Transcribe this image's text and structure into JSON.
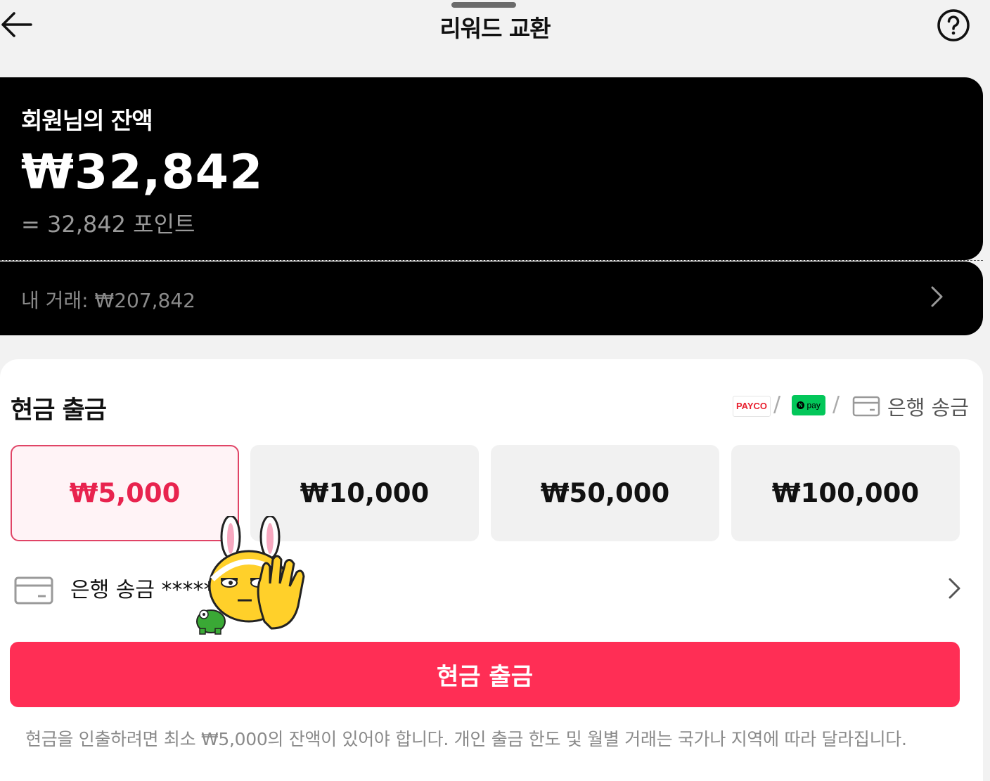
{
  "header": {
    "title": "리워드 교환",
    "back_icon": "arrow-left-icon",
    "help_icon": "question-circle-icon"
  },
  "balance": {
    "label": "회원님의 잔액",
    "amount": "₩32,842",
    "points": "= 32,842 포인트",
    "transactions": "내 거래: ₩207,842"
  },
  "withdraw": {
    "title": "현금 출금",
    "methods": {
      "payco": "PAYCO",
      "npay": "pay",
      "separator": "/",
      "bank": "은행 송금"
    },
    "amounts": [
      {
        "label": "₩5,000",
        "selected": true
      },
      {
        "label": "₩10,000",
        "selected": false
      },
      {
        "label": "₩50,000",
        "selected": false
      },
      {
        "label": "₩100,000",
        "selected": false
      }
    ],
    "bank_account": "은행 송금 *****",
    "button": "현금 출금",
    "notice": "현금을 인출하려면 최소 ₩5,000의 잔액이 있어야 합니다. 개인 출금 한도 및 월별 거래는 국가나 지역에 따라 달라집니다."
  },
  "colors": {
    "accent": "#ff2e55",
    "selected_text": "#e8234e",
    "card_bg": "#000000",
    "npay_green": "#03c75a"
  }
}
